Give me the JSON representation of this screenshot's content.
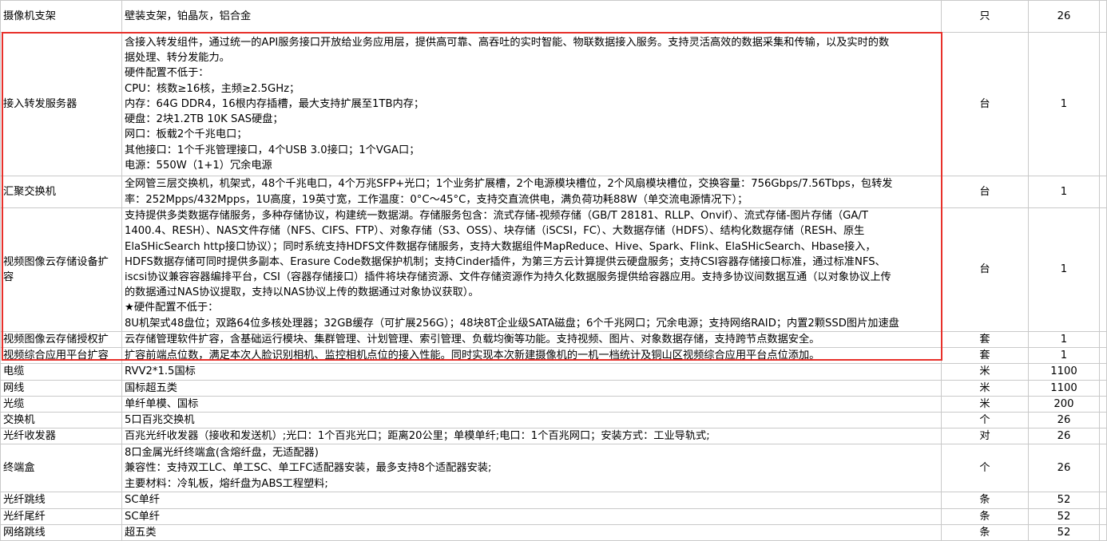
{
  "rows": [
    {
      "name": "摄像机支架",
      "desc": [
        "壁装支架，铂晶灰，铝合金"
      ],
      "unit": "只",
      "qty": "26"
    },
    {
      "name": "接入转发服务器",
      "desc": [
        "含接入转发组件，通过统一的API服务接口开放给业务应用层，提供高可靠、高吞吐的实时智能、物联数据接入服务。支持灵活高效的数据采集和传输，以及实时的数",
        "据处理、转分发能力。",
        "硬件配置不低于：",
        "CPU：核数≥16核，主频≥2.5GHz；",
        "内存：64G DDR4，16根内存插槽，最大支持扩展至1TB内存；",
        "硬盘：2块1.2TB 10K SAS硬盘；",
        "网口：板载2个千兆电口；",
        "其他接口：1个千兆管理接口，4个USB 3.0接口；1个VGA口；",
        "电源：550W（1+1）冗余电源"
      ],
      "unit": "台",
      "qty": "1"
    },
    {
      "name": "汇聚交换机",
      "desc": [
        "全网管三层交换机，机架式，48个千兆电口，4个万兆SFP+光口；1个业务扩展槽，2个电源模块槽位，2个风扇模块槽位，交换容量：756Gbps/7.56Tbps，包转发",
        "率：252Mpps/432Mpps，1U高度，19英寸宽，工作温度：0°C～45°C，支持交直流供电，满负荷功耗88W（单交流电源情况下）；"
      ],
      "unit": "台",
      "qty": "1"
    },
    {
      "name": "视频图像云存储设备扩容",
      "desc": [
        "支持提供多类数据存储服务，多种存储协议，构建统一数据湖。存储服务包含：流式存储-视频存储（GB/T 28181、RLLP、Onvif）、流式存储-图片存储（GA/T",
        "1400.4、RESH）、NAS文件存储（NFS、CIFS、FTP）、对象存储（S3、OSS）、块存储（iSCSI，FC）、大数据存储（HDFS）、结构化数据存储（RESH、原生",
        "ElaSHicSearch http接口协议）；同时系统支持HDFS文件数据存储服务，支持大数据组件MapReduce、Hive、Spark、Flink、ElaSHicSearch、Hbase接入，",
        "HDFS数据存储可同时提供多副本、Erasure Code数据保护机制；支持Cinder插件，为第三方云计算提供云硬盘服务；支持CSI容器存储接口标准，通过标准NFS、",
        "iscsi协议兼容容器编排平台，CSI（容器存储接口）插件将块存储资源、文件存储资源作为持久化数据服务提供给容器应用。支持多协议间数据互通（以对象协议上传",
        "的数据通过NAS协议提取，支持以NAS协议上传的数据通过对象协议获取）。",
        "★硬件配置不低于：",
        "8U机架式48盘位；双路64位多核处理器；32GB缓存（可扩展256G）；48块8T企业级SATA磁盘；6个千兆网口；冗余电源；支持网络RAID；内置2颗SSD图片加速盘"
      ],
      "unit": "台",
      "qty": "1"
    },
    {
      "name": "视频图像云存储授权扩",
      "desc": [
        "云存储管理软件扩容，含基础运行模块、集群管理、计划管理、索引管理、负载均衡等功能。支持视频、图片、对象数据存储，支持跨节点数据安全。"
      ],
      "unit": "套",
      "qty": "1"
    },
    {
      "name": "视频综合应用平台扩容",
      "desc": [
        "扩容前端点位数，满足本次人脸识别相机、监控相机点位的接入性能。同时实现本次新建摄像机的一机一档统计及铜山区视频综合应用平台点位添加。"
      ],
      "unit": "套",
      "qty": "1"
    },
    {
      "name": "电缆",
      "desc": [
        "RVV2*1.5国标"
      ],
      "unit": "米",
      "qty": "1100"
    },
    {
      "name": "网线",
      "desc": [
        "国标超五类"
      ],
      "unit": "米",
      "qty": "1100"
    },
    {
      "name": "光缆",
      "desc": [
        "单纤单模、国标"
      ],
      "unit": "米",
      "qty": "200"
    },
    {
      "name": "交换机",
      "desc": [
        "5口百兆交换机"
      ],
      "unit": "个",
      "qty": "26"
    },
    {
      "name": "光纤收发器",
      "desc": [
        "百兆光纤收发器（接收和发送机）;光口：1个百兆光口；距离20公里；单模单纤;电口：1个百兆网口；安装方式：工业导轨式;"
      ],
      "unit": "对",
      "qty": "26"
    },
    {
      "name": "终端盒",
      "desc": [
        "8口金属光纤终端盒(含熔纤盘，无适配器)",
        "兼容性：支持双工LC、单工SC、单工FC适配器安装，最多支持8个适配器安装;",
        "主要材料：冷轧板，熔纤盘为ABS工程塑料;"
      ],
      "unit": "个",
      "qty": "26"
    },
    {
      "name": "光纤跳线",
      "desc": [
        "SC单纤"
      ],
      "unit": "条",
      "qty": "52"
    },
    {
      "name": "光纤尾纤",
      "desc": [
        "SC单纤"
      ],
      "unit": "条",
      "qty": "52"
    },
    {
      "name": "网络跳线",
      "desc": [
        "超五类"
      ],
      "unit": "条",
      "qty": "52"
    }
  ]
}
